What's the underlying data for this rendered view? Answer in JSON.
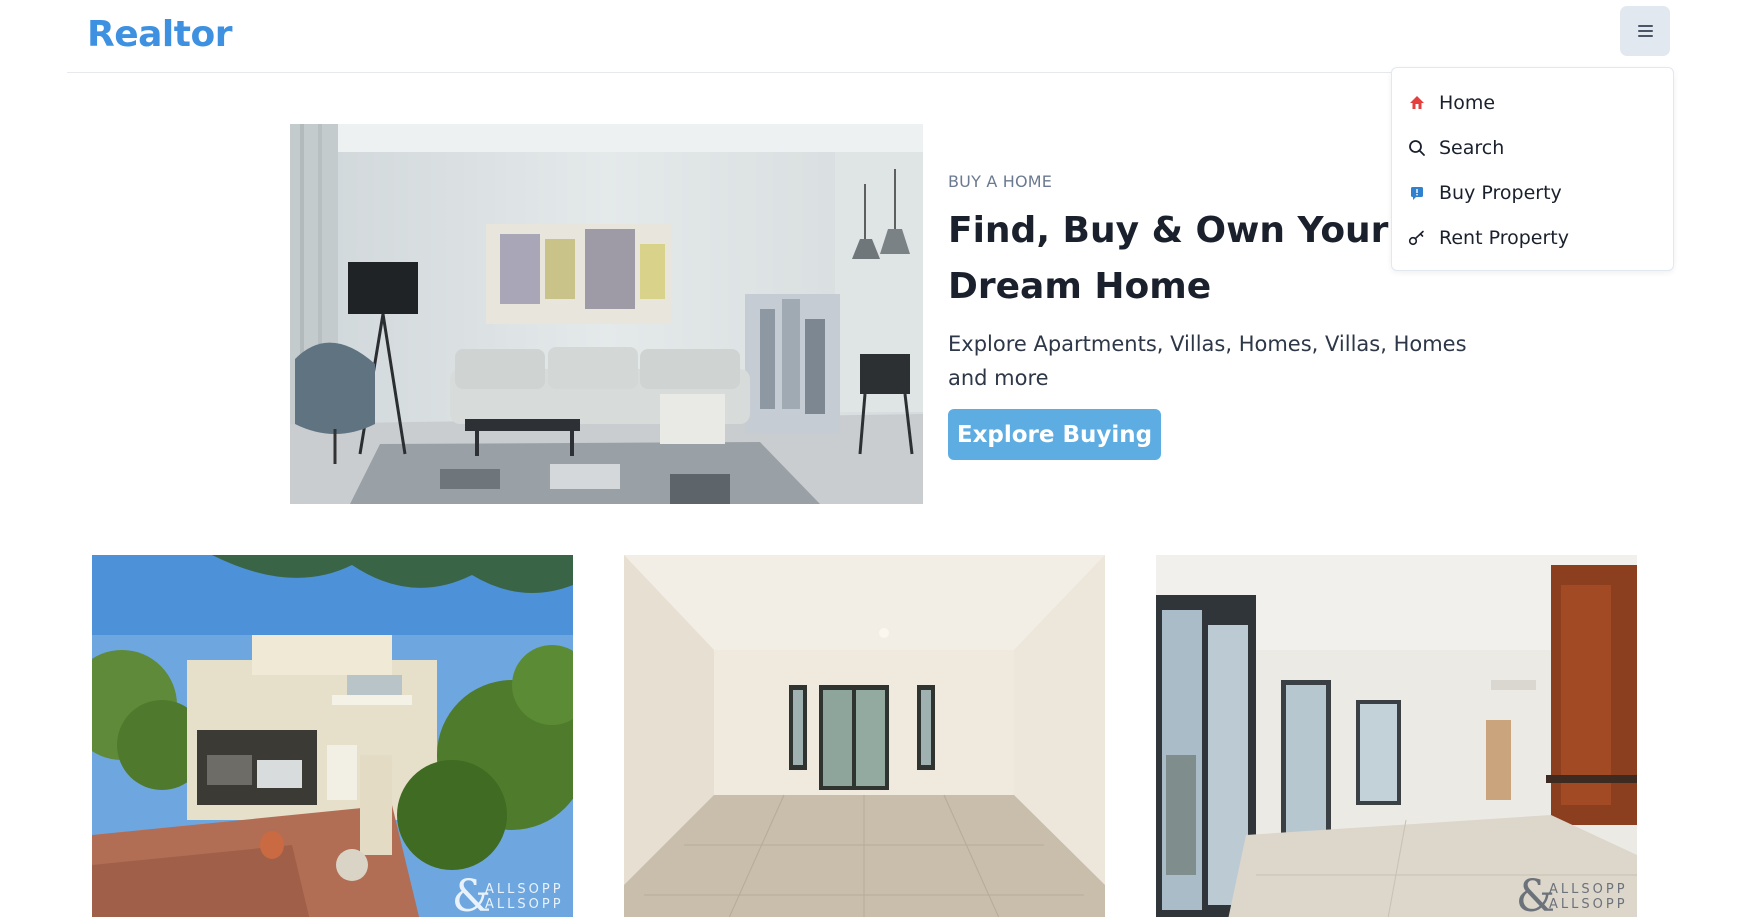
{
  "navbar": {
    "logo": "Realtor",
    "menu_button_icon": "hamburger-icon"
  },
  "menu": {
    "items": [
      {
        "label": "Home",
        "icon": "home-icon"
      },
      {
        "label": "Search",
        "icon": "search-icon"
      },
      {
        "label": "Buy Property",
        "icon": "buy-property-icon"
      },
      {
        "label": "Rent Property",
        "icon": "key-icon"
      }
    ]
  },
  "hero": {
    "eyebrow": "BUY A HOME",
    "title": "Find, Buy & Own Your Dream Home",
    "description": "Explore Apartments, Villas, Homes, Villas, Homes and more",
    "cta_label": "Explore Buying"
  },
  "listings": [
    {
      "watermark": "ALLSOPP ALLSOPP",
      "watermark_mark": "&"
    },
    {
      "watermark": ""
    },
    {
      "watermark": "ALLSOPP ALLSOPP",
      "watermark_mark": "&"
    }
  ],
  "colors": {
    "brand": "#3d91e0",
    "cta": "#5dade2",
    "menu_button_bg": "#e2e8f0"
  }
}
